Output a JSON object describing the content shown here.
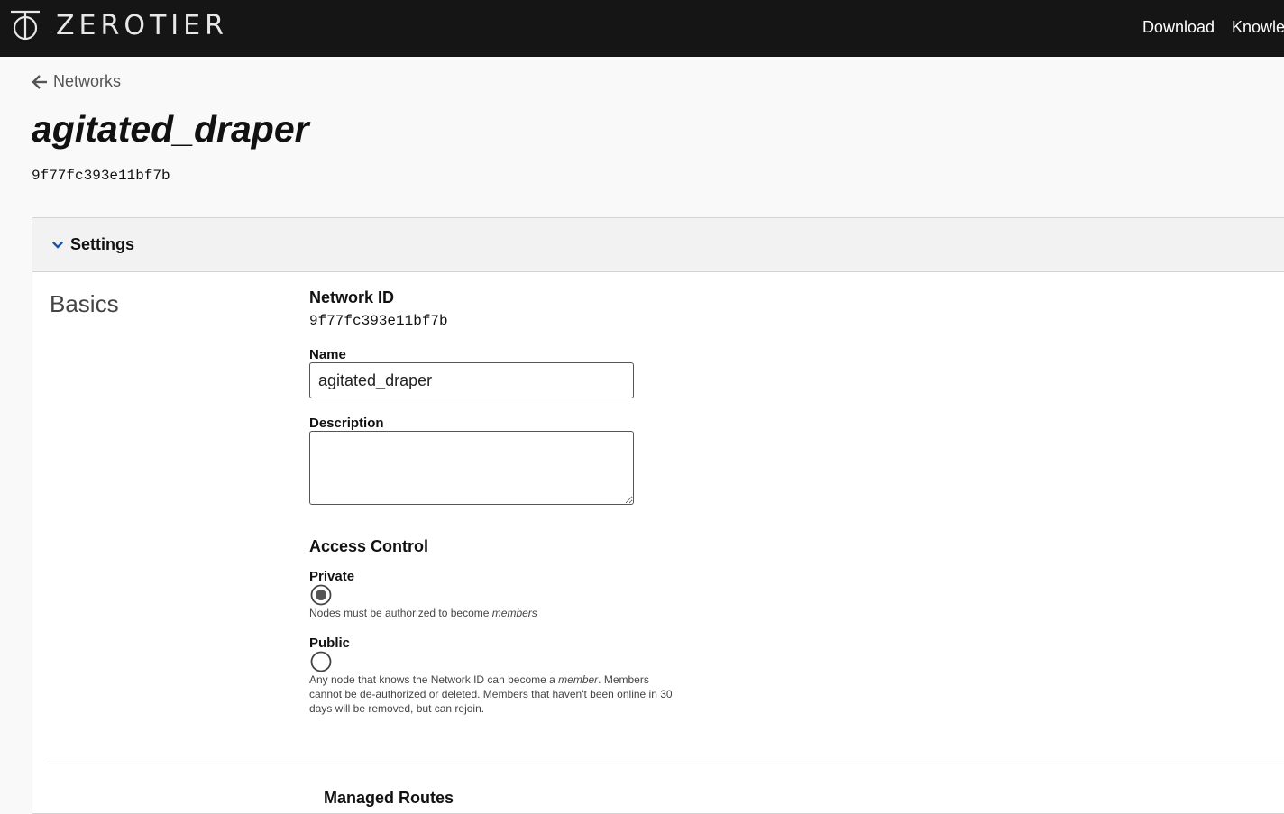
{
  "header": {
    "logo_text": "ZEROTIER",
    "nav": [
      "Download",
      "Knowle"
    ]
  },
  "breadcrumb": {
    "back_label": "Networks"
  },
  "network": {
    "name": "agitated_draper",
    "id": "9f77fc393e11bf7b"
  },
  "settings": {
    "toggle_label": "Settings",
    "section_title": "Basics",
    "network_id_label": "Network ID",
    "network_id_value": "9f77fc393e11bf7b",
    "name_label": "Name",
    "name_value": "agitated_draper",
    "description_label": "Description",
    "description_value": "",
    "access_control_title": "Access Control",
    "access_options": [
      {
        "label": "Private",
        "selected": true,
        "help_prefix": "Nodes must be authorized to become ",
        "help_emph": "members",
        "help_suffix": ""
      },
      {
        "label": "Public",
        "selected": false,
        "help_prefix": "Any node that knows the Network ID can become a ",
        "help_emph": "member",
        "help_suffix": ". Members cannot be de-authorized or deleted. Members that haven't been online in 30 days will be removed, but can rejoin."
      }
    ],
    "next_section_label": "Managed Routes"
  }
}
